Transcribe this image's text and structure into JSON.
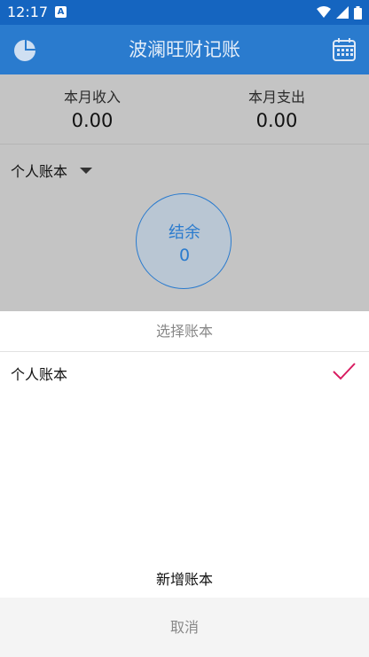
{
  "status_bar": {
    "time": "12:17",
    "notification_icon": "A"
  },
  "app_bar": {
    "title": "波澜旺财记账",
    "left_icon": "pie-chart-icon",
    "right_icon": "calendar-icon"
  },
  "summary": {
    "income_label": "本月收入",
    "income_value": "0.00",
    "expense_label": "本月支出",
    "expense_value": "0.00"
  },
  "book_selector": {
    "label": "个人账本"
  },
  "balance": {
    "label": "结余",
    "value": "0"
  },
  "sheet": {
    "title": "选择账本",
    "books": [
      {
        "name": "个人账本",
        "selected": true
      }
    ],
    "add_label": "新增账本",
    "cancel_label": "取消"
  },
  "colors": {
    "primary": "#2A7BCE",
    "status_bar": "#1565C0",
    "check": "#D81B60"
  }
}
